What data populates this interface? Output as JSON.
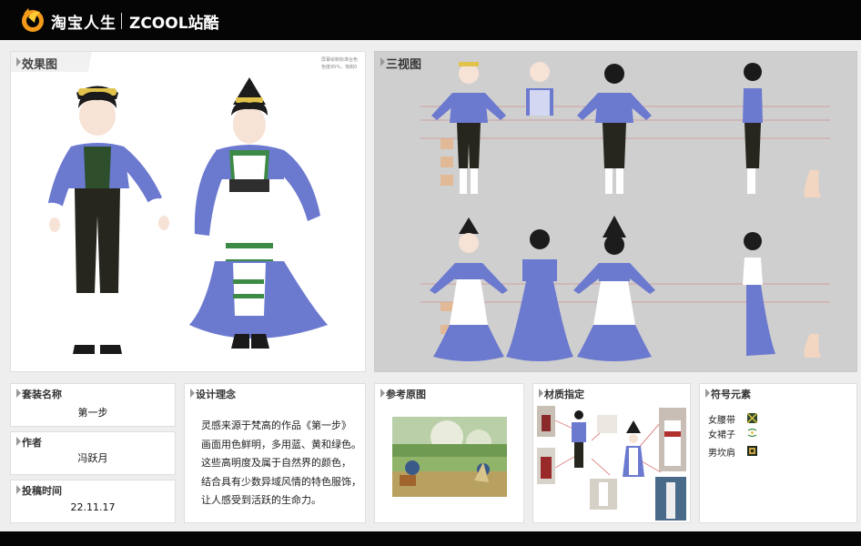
{
  "header": {
    "brand_primary": "淘宝人生",
    "brand_secondary": "ZCOOL站酷",
    "logo_icon": "taobao-life-logo-icon"
  },
  "effect_panel": {
    "title": "效果图",
    "note_line1": "屏幕绘制标准台色",
    "note_line2": "色度95%，饱和0"
  },
  "three_view_panel": {
    "title": "三视图"
  },
  "info": {
    "outfit_name_label": "套装名称",
    "outfit_name_value": "第一步",
    "author_label": "作者",
    "author_value": "冯跃月",
    "date_label": "投稿时间",
    "date_value": "22.11.17"
  },
  "design_concept": {
    "title": "设计理念",
    "lines": [
      "灵感来源于梵高的作品《第一步》",
      "画面用色鲜明，多用蓝、黄和绿色。",
      "这些高明度及属于自然界的颜色，",
      "结合具有少数异域风情的特色服饰，",
      "让人感受到活跃的生命力。"
    ]
  },
  "reference": {
    "title": "参考原图"
  },
  "material": {
    "title": "材质指定"
  },
  "symbols": {
    "title": "符号元素",
    "items": [
      {
        "label": "女腰带",
        "icon": "waist-belt-pattern-icon"
      },
      {
        "label": "女裙子",
        "icon": "skirt-pattern-icon"
      },
      {
        "label": "男坎肩",
        "icon": "vest-pattern-icon"
      }
    ]
  },
  "colors": {
    "topbar": "#050505",
    "costume_blue": "#6b79cf",
    "accent_yellow": "#e7c25a",
    "accent_green": "#3c8a45",
    "three_view_bg": "#cfcfcf"
  }
}
